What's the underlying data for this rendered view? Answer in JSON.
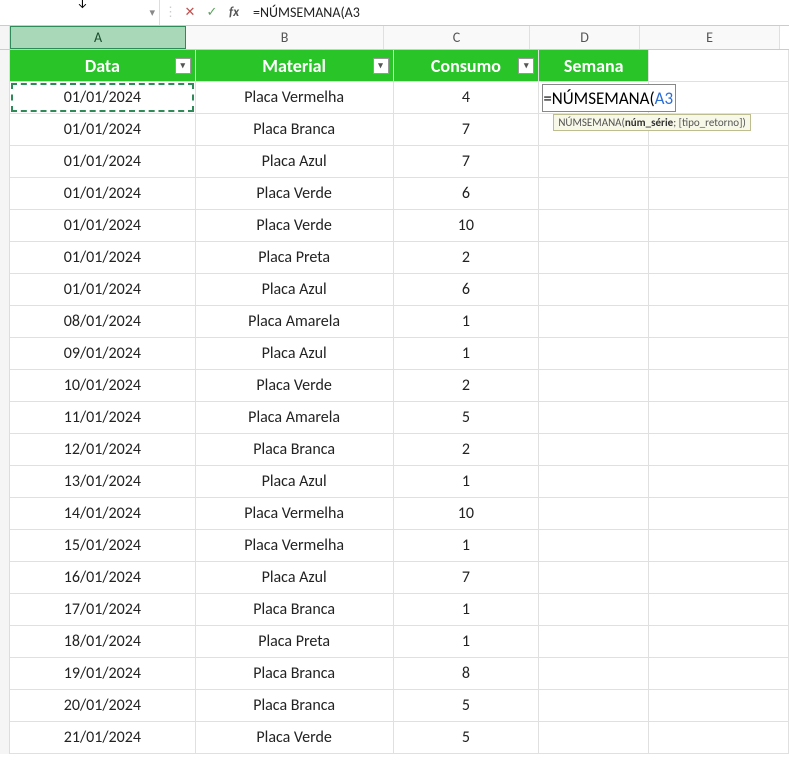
{
  "formula_bar": {
    "fx_label": "fx",
    "formula_text": "=NÚMSEMANA(A3"
  },
  "column_letters": {
    "A": "A",
    "B": "B",
    "C": "C",
    "D": "D",
    "E": "E"
  },
  "table_headers": {
    "data": "Data",
    "material": "Material",
    "consumo": "Consumo",
    "semana": "Semana"
  },
  "formula_cell": {
    "prefix": "=NÚMSEMANA(",
    "ref": "A3"
  },
  "tooltip": {
    "func": "NÚMSEMANA(",
    "arg1": "núm_série",
    "rest": "; [tipo_retorno])"
  },
  "rows": [
    {
      "data": "01/01/2024",
      "material": "Placa Vermelha",
      "consumo": "4"
    },
    {
      "data": "01/01/2024",
      "material": "Placa Branca",
      "consumo": "7"
    },
    {
      "data": "01/01/2024",
      "material": "Placa Azul",
      "consumo": "7"
    },
    {
      "data": "01/01/2024",
      "material": "Placa Verde",
      "consumo": "6"
    },
    {
      "data": "01/01/2024",
      "material": "Placa Verde",
      "consumo": "10"
    },
    {
      "data": "01/01/2024",
      "material": "Placa Preta",
      "consumo": "2"
    },
    {
      "data": "01/01/2024",
      "material": "Placa Azul",
      "consumo": "6"
    },
    {
      "data": "08/01/2024",
      "material": "Placa Amarela",
      "consumo": "1"
    },
    {
      "data": "09/01/2024",
      "material": "Placa Azul",
      "consumo": "1"
    },
    {
      "data": "10/01/2024",
      "material": "Placa Verde",
      "consumo": "2"
    },
    {
      "data": "11/01/2024",
      "material": "Placa Amarela",
      "consumo": "5"
    },
    {
      "data": "12/01/2024",
      "material": "Placa Branca",
      "consumo": "2"
    },
    {
      "data": "13/01/2024",
      "material": "Placa Azul",
      "consumo": "1"
    },
    {
      "data": "14/01/2024",
      "material": "Placa Vermelha",
      "consumo": "10"
    },
    {
      "data": "15/01/2024",
      "material": "Placa Vermelha",
      "consumo": "1"
    },
    {
      "data": "16/01/2024",
      "material": "Placa Azul",
      "consumo": "7"
    },
    {
      "data": "17/01/2024",
      "material": "Placa Branca",
      "consumo": "1"
    },
    {
      "data": "18/01/2024",
      "material": "Placa Preta",
      "consumo": "1"
    },
    {
      "data": "19/01/2024",
      "material": "Placa Branca",
      "consumo": "8"
    },
    {
      "data": "20/01/2024",
      "material": "Placa Branca",
      "consumo": "5"
    },
    {
      "data": "21/01/2024",
      "material": "Placa Verde",
      "consumo": "5"
    }
  ]
}
